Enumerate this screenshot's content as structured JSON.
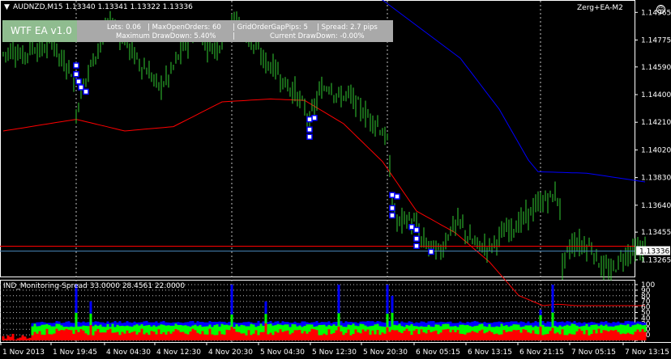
{
  "symbol_header": "AUDNZD,M15  1.13340 1.13341 1.13322 1.13336",
  "header_arrow": "▼",
  "ea_badge": "Zerg+EA-M2",
  "ea_panel": {
    "title": "WTF EA v1.0",
    "lots": "Lots: 0.06",
    "max_open_orders": "|   MaxOpenOrders: 60",
    "grid_gap": "|   GridOrderGapPips: 5",
    "spread": "|   Spread: 2.7 pips",
    "max_drawdown": "Maximum DrawDown: 5.40%",
    "sep": "|",
    "current_drawdown": "Current DrawDown: -0.00%"
  },
  "current_price_label": "1.13336",
  "indicator_label": "IND_Monitoring-Spread 33.0000 28.4561 22.0000",
  "colors": {
    "background": "#000000",
    "candle": "#32cd32",
    "ma_fast": "#ff0000",
    "ma_slow": "#0000ff",
    "price_line": "#4682b4",
    "grid": "#c0c0c0",
    "hist_red": "#ff0000",
    "hist_green": "#00ff00",
    "hist_blue": "#0000ff",
    "orders": "#0000ff"
  },
  "chart_data": [
    {
      "type": "candlestick",
      "title": "AUDNZD,M15",
      "y_ticks": [
        "1.14965",
        "1.14775",
        "1.14590",
        "1.14400",
        "1.14210",
        "1.14020",
        "1.13830",
        "1.13640",
        "1.13455",
        "1.13265"
      ],
      "ylim": [
        1.1315,
        1.1505
      ],
      "x_ticks": [
        "1 Nov 2013",
        "1 Nov 19:45",
        "4 Nov 04:30",
        "4 Nov 12:30",
        "4 Nov 20:30",
        "5 Nov 04:30",
        "5 Nov 12:30",
        "5 Nov 20:30",
        "6 Nov 05:15",
        "6 Nov 13:15",
        "6 Nov 21:15",
        "7 Nov 05:15",
        "7 Nov 13:15"
      ],
      "current_price": 1.13336,
      "bid_line": 1.1336,
      "price_path": [
        [
          0,
          1.1468
        ],
        [
          4,
          1.1471
        ],
        [
          8,
          1.1466
        ],
        [
          12,
          1.1473
        ],
        [
          16,
          1.147
        ],
        [
          20,
          1.1478
        ],
        [
          24,
          1.1463
        ],
        [
          28,
          1.1457
        ],
        [
          30,
          1.1428
        ],
        [
          33,
          1.1447
        ],
        [
          36,
          1.146
        ],
        [
          40,
          1.1476
        ],
        [
          44,
          1.1488
        ],
        [
          48,
          1.1482
        ],
        [
          52,
          1.1472
        ],
        [
          56,
          1.1462
        ],
        [
          60,
          1.1455
        ],
        [
          64,
          1.1445
        ],
        [
          68,
          1.1452
        ],
        [
          72,
          1.1466
        ],
        [
          76,
          1.1476
        ],
        [
          80,
          1.1486
        ],
        [
          84,
          1.1474
        ],
        [
          88,
          1.1472
        ],
        [
          92,
          1.1486
        ],
        [
          96,
          1.1492
        ],
        [
          100,
          1.148
        ],
        [
          104,
          1.1472
        ],
        [
          108,
          1.1462
        ],
        [
          112,
          1.1458
        ],
        [
          116,
          1.1447
        ],
        [
          120,
          1.1442
        ],
        [
          124,
          1.143
        ],
        [
          126,
          1.1422
        ],
        [
          130,
          1.1441
        ],
        [
          134,
          1.1447
        ],
        [
          138,
          1.1438
        ],
        [
          142,
          1.144
        ],
        [
          146,
          1.1432
        ],
        [
          150,
          1.1425
        ],
        [
          154,
          1.142
        ],
        [
          158,
          1.1408
        ],
        [
          160,
          1.1368
        ],
        [
          162,
          1.1352
        ],
        [
          166,
          1.1355
        ],
        [
          170,
          1.135
        ],
        [
          172,
          1.134
        ],
        [
          176,
          1.1335
        ],
        [
          180,
          1.1332
        ],
        [
          184,
          1.1348
        ],
        [
          188,
          1.1352
        ],
        [
          192,
          1.134
        ],
        [
          196,
          1.1336
        ],
        [
          200,
          1.1335
        ],
        [
          204,
          1.1342
        ],
        [
          208,
          1.1348
        ],
        [
          212,
          1.1351
        ],
        [
          216,
          1.1358
        ],
        [
          220,
          1.1364
        ],
        [
          224,
          1.1369
        ],
        [
          228,
          1.1371
        ],
        [
          229,
          1.136
        ],
        [
          230,
          1.1323
        ],
        [
          234,
          1.1338
        ],
        [
          238,
          1.1337
        ],
        [
          242,
          1.1335
        ],
        [
          246,
          1.1322
        ],
        [
          250,
          1.1318
        ],
        [
          254,
          1.1327
        ],
        [
          258,
          1.1333
        ],
        [
          262,
          1.1333
        ],
        [
          264,
          1.1335
        ]
      ],
      "ma_fast": [
        [
          0,
          1.1415
        ],
        [
          30,
          1.1423
        ],
        [
          50,
          1.1415
        ],
        [
          70,
          1.1418
        ],
        [
          90,
          1.1435
        ],
        [
          110,
          1.1437
        ],
        [
          124,
          1.1436
        ],
        [
          140,
          1.142
        ],
        [
          156,
          1.1394
        ],
        [
          170,
          1.136
        ],
        [
          186,
          1.1345
        ],
        [
          200,
          1.1325
        ],
        [
          212,
          1.1302
        ],
        [
          222,
          1.1295
        ],
        [
          228,
          1.1296
        ],
        [
          236,
          1.1295
        ],
        [
          264,
          1.1295
        ]
      ],
      "ma_slow": [
        [
          0,
          1.153
        ],
        [
          30,
          1.153
        ],
        [
          60,
          1.1525
        ],
        [
          90,
          1.1525
        ],
        [
          126,
          1.1525
        ],
        [
          140,
          1.1515
        ],
        [
          156,
          1.1505
        ],
        [
          172,
          1.1485
        ],
        [
          188,
          1.1465
        ],
        [
          204,
          1.143
        ],
        [
          216,
          1.1395
        ],
        [
          220,
          1.1387
        ],
        [
          240,
          1.1386
        ],
        [
          264,
          1.138
        ]
      ],
      "order_markers": [
        [
          30,
          1.146
        ],
        [
          30,
          1.1454
        ],
        [
          31,
          1.1449
        ],
        [
          32,
          1.1445
        ],
        [
          34,
          1.1442
        ],
        [
          128,
          1.1424
        ],
        [
          126,
          1.1423
        ],
        [
          126,
          1.1416
        ],
        [
          126,
          1.1411
        ],
        [
          160,
          1.1371
        ],
        [
          162,
          1.137
        ],
        [
          160,
          1.1362
        ],
        [
          160,
          1.1357
        ],
        [
          168,
          1.1349
        ],
        [
          170,
          1.1347
        ],
        [
          170,
          1.1341
        ],
        [
          170,
          1.1336
        ],
        [
          176,
          1.1332
        ]
      ]
    },
    {
      "type": "bar",
      "title": "IND_Monitoring-Spread 33.0000 28.4561 22.0000",
      "y_ticks": [
        "100",
        "90",
        "80",
        "70",
        "60",
        "50",
        "40",
        "30",
        "20",
        "10",
        "0"
      ],
      "ylim": [
        0,
        100
      ],
      "spikes": [
        [
          30,
          100
        ],
        [
          30,
          80
        ],
        [
          36,
          70
        ],
        [
          94,
          100
        ],
        [
          108,
          70
        ],
        [
          138,
          100
        ],
        [
          158,
          100
        ],
        [
          160,
          80
        ],
        [
          226,
          100
        ],
        [
          221,
          55
        ]
      ],
      "stack_levels": {
        "red_typical": 15,
        "green_typical": 27,
        "blue_typical": 33
      }
    }
  ]
}
